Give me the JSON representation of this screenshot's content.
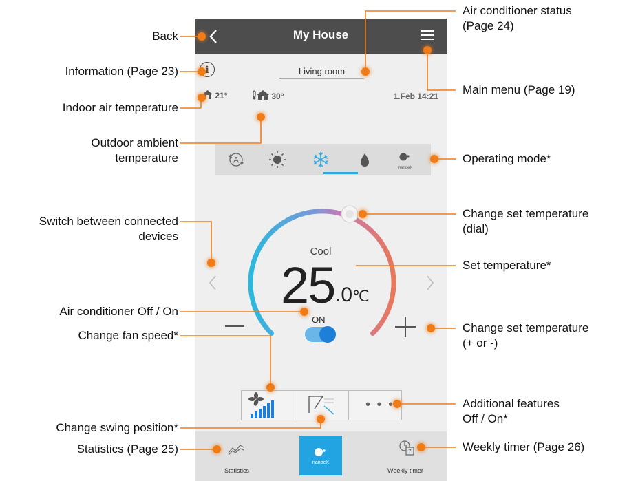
{
  "app": {
    "title": "My House",
    "room": "Living room",
    "indoor_temp": "21°",
    "outdoor_temp": "30°",
    "datetime": "1.Feb 14:21"
  },
  "modes": [
    {
      "icon": "auto-mode-icon"
    },
    {
      "icon": "sun-heat-icon"
    },
    {
      "icon": "snowflake-cool-icon",
      "selected": true
    },
    {
      "icon": "droplet-dry-icon"
    },
    {
      "icon": "nanoe-x-icon",
      "label": "nanoeX"
    }
  ],
  "dial": {
    "mode_label": "Cool",
    "set_temp_main": "25",
    "set_temp_fraction": ".0",
    "unit": "℃",
    "power_label": "ON",
    "power_on": true
  },
  "controls": {
    "more_label": "• • •"
  },
  "footer": {
    "statistics_label": "Statistics",
    "nanoe_label": "nanoeX",
    "weekly_label": "Weekly timer"
  },
  "colors": {
    "accent_orange": "#f07c18",
    "topbar": "#4d4d4d",
    "blue": "#22a3e2"
  },
  "annotations": {
    "back": "Back",
    "information": "Information (Page 23)",
    "indoor": "Indoor air temperature",
    "outdoor_1": "Outdoor ambient",
    "outdoor_2": "temperature",
    "switch_1": "Switch between connected",
    "switch_2": "devices",
    "off_on": "Air conditioner Off / On",
    "fan": "Change fan speed*",
    "swing": "Change swing position*",
    "statistics": "Statistics (Page 25)",
    "status_1": "Air conditioner status",
    "status_2": "(Page 24)",
    "main_menu": "Main menu (Page 19)",
    "operating_mode": "Operating mode*",
    "dial_1": "Change set temperature",
    "dial_2": "(dial)",
    "set_temp": "Set temperature*",
    "plusminus_1": "Change set temperature",
    "plusminus_2": "(+ or -)",
    "additional_1": "Additional features",
    "additional_2": "Off / On*",
    "weekly": "Weekly timer (Page 26)"
  }
}
